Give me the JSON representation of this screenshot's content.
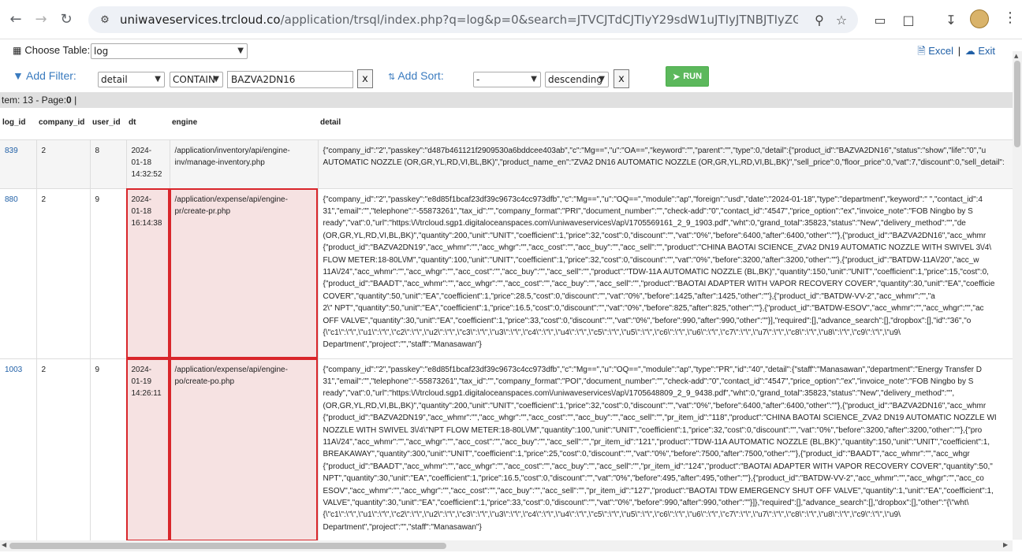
{
  "browser": {
    "url_host": "uniwaveservices.trcloud.co",
    "url_path": "/application/trsql/index.php?q=log&p=0&search=JTVCJTdCJTIyY29sdW1uJTIyJTNBJTIyZGV0YWlsJTIyJTJDJ..."
  },
  "toolbar": {
    "choose_table_label": "Choose Table:",
    "table_value": "log",
    "excel_label": "Excel",
    "separator": "|",
    "exit_label": "Exit",
    "add_filter_label": "Add Filter:",
    "filter_column": "detail",
    "filter_op": "CONTAIN",
    "filter_value": "BAZVA2DN16",
    "x_label": "x",
    "add_sort_label": "Add Sort:",
    "sort_column": "-",
    "sort_order": "descending",
    "run_label": "RUN",
    "item_info_prefix": "tem: 13 - Page:",
    "page_number": "0",
    "item_info_suffix": " |"
  },
  "columns": [
    "log_id",
    "company_id",
    "user_id",
    "dt",
    "engine",
    "detail"
  ],
  "rows": [
    {
      "log_id": "839",
      "company_id": "2",
      "user_id": "8",
      "dt": "2024-\n01-18\n14:32:52",
      "engine": "/application/inventory/api/engine-inv/manage-inventory.php",
      "detail": "{\"company_id\":\"2\",\"passkey\":\"d487b461121f2909530a6bddcee403ab\",\"c\":\"Mg==\",\"u\":\"OA==\",\"keyword\":\"\",\"parent\":\"\",\"type\":0,\"detail\":{\"product_id\":\"BAZVA2DN16\",\"status\":\"show\",\"life\":\"0\",\"u\nAUTOMATIC NOZZLE (OR,GR,YL,RD,VI,BL,BK)\",\"product_name_en\":\"ZVA2 DN16 AUTOMATIC NOZZLE (OR,GR,YL,RD,VI,BL,BK)\",\"sell_price\":0,\"floor_price\":0,\"vat\":7,\"discount\":0,\"sell_detail\":"
    },
    {
      "log_id": "880",
      "company_id": "2",
      "user_id": "9",
      "dt": "2024-\n01-18\n16:14:38",
      "engine": "/application/expense/api/engine-pr/create-pr.php",
      "detail": "{\"company_id\":\"2\",\"passkey\":\"e8d85f1bcaf23df39c9673c4cc973dfb\",\"c\":\"Mg==\",\"u\":\"OQ==\",\"module\":\"ap\",\"foreign\":\"usd\",\"date\":\"2024-01-18\",\"type\":\"department\",\"keyword\":\" \",\"contact_id\":4\n31\",\"email\":\"\",\"telephone\":\"-55873261\",\"tax_id\":\"\",\"company_format\":\"PRI\",\"document_number\":\"\",\"check-add\":\"0\",\"contact_id\":\"4547\",\"price_option\":\"ex\",\"invoice_note\":\"FOB Ningbo by S\nready\",\"vat\":0,\"url\":\"https:\\/\\/trcloud.sgp1.digitaloceanspaces.com\\/uniwaveservices\\/ap\\/1705569161_2_9_1903.pdf\",\"wht\":0,\"grand_total\":35823,\"status\":\"New\",\"delivery_method\":\"\",\"de\n(OR,GR,YL,RD,VI,BL,BK)\",\"quantity\":200,\"unit\":\"UNIT\",\"coefficient\":1,\"price\":32,\"cost\":0,\"discount\":\"\",\"vat\":\"0%\",\"before\":6400,\"after\":6400,\"other\":\"\"},{\"product_id\":\"BAZVA2DN16\",\"acc_whmr\n{\"product_id\":\"BAZVA2DN19\",\"acc_whmr\":\"\",\"acc_whgr\":\"\",\"acc_cost\":\"\",\"acc_buy\":\"\",\"acc_sell\":\"\",\"product\":\"CHINA BAOTAI SCIENCE_ZVA2 DN19 AUTOMATIC NOZZLE WITH SWIVEL 3\\/4\\\nFLOW METER:18-80L\\/M\",\"quantity\":100,\"unit\":\"UNIT\",\"coefficient\":1,\"price\":32,\"cost\":0,\"discount\":\"\",\"vat\":\"0%\",\"before\":3200,\"after\":3200,\"other\":\"\"},{\"product_id\":\"BATDW-11A\\/20\",\"acc_w\n11A\\/24\",\"acc_whmr\":\"\",\"acc_whgr\":\"\",\"acc_cost\":\"\",\"acc_buy\":\"\",\"acc_sell\":\"\",\"product\":\"TDW-11A AUTOMATIC NOZZLE (BL,BK)\",\"quantity\":150,\"unit\":\"UNIT\",\"coefficient\":1,\"price\":15,\"cost\":0,\n{\"product_id\":\"BAADT\",\"acc_whmr\":\"\",\"acc_whgr\":\"\",\"acc_cost\":\"\",\"acc_buy\":\"\",\"acc_sell\":\"\",\"product\":\"BAOTAI ADAPTER WITH VAPOR RECOVERY COVER\",\"quantity\":30,\"unit\":\"EA\",\"coefficie\nCOVER\",\"quantity\":50,\"unit\":\"EA\",\"coefficient\":1,\"price\":28.5,\"cost\":0,\"discount\":\"\",\"vat\":\"0%\",\"before\":1425,\"after\":1425,\"other\":\"\"},{\"product_id\":\"BATDW-VV-2\",\"acc_whmr\":\"\",\"a\n2\\\" NPT\",\"quantity\":50,\"unit\":\"EA\",\"coefficient\":1,\"price\":16.5,\"cost\":0,\"discount\":\"\",\"vat\":\"0%\",\"before\":825,\"after\":825,\"other\":\"\"},{\"product_id\":\"BATDW-ESOV\",\"acc_whmr\":\"\",\"acc_whgr\":\"\",\"ac\nOFF VALVE\",\"quantity\":30,\"unit\":\"EA\",\"coefficient\":1,\"price\":33,\"cost\":0,\"discount\":\"\",\"vat\":\"0%\",\"before\":990,\"after\":990,\"other\":\"\"}],\"required\":[],\"advance_search\":[],\"dropbox\":[],\"id\":\"36\",\"o\n{\\\"c1\\\":\\\"\\\",\\\"u1\\\":\\\"\\\",\\\"c2\\\":\\\"\\\",\\\"u2\\\":\\\"\\\",\\\"c3\\\":\\\"\\\",\\\"u3\\\":\\\"\\\",\\\"c4\\\":\\\"\\\",\\\"u4\\\":\\\"\\\",\\\"c5\\\":\\\"\\\",\\\"u5\\\":\\\"\\\",\\\"c6\\\":\\\"\\\",\\\"u6\\\":\\\"\\\",\\\"c7\\\":\\\"\\\",\\\"u7\\\":\\\"\\\",\\\"c8\\\":\\\"\\\",\\\"u8\\\":\\\"\\\",\\\"c9\\\":\\\"\\\",\\\"u9\\\nDepartment\",\"project\":\"\",\"staff\":\"Manasawan\"}"
    },
    {
      "log_id": "1003",
      "company_id": "2",
      "user_id": "9",
      "dt": "2024-\n01-19\n14:26:11",
      "engine": "/application/expense/api/engine-po/create-po.php",
      "detail": "{\"company_id\":\"2\",\"passkey\":\"e8d85f1bcaf23df39c9673c4cc973dfb\",\"c\":\"Mg==\",\"u\":\"OQ==\",\"module\":\"ap\",\"type\":\"PR\",\"id\":\"40\",\"detail\":{\"staff\":\"Manasawan\",\"department\":\"Energy Transfer D\n31\",\"email\":\"\",\"telephone\":\"-55873261\",\"tax_id\":\"\",\"company_format\":\"POI\",\"document_number\":\"\",\"check-add\":\"0\",\"contact_id\":\"4547\",\"price_option\":\"ex\",\"invoice_note\":\"FOB Ningbo by S\nready\",\"vat\":0,\"url\":\"https:\\/\\/trcloud.sgp1.digitaloceanspaces.com\\/uniwaveservices\\/ap\\/1705648809_2_9_9438.pdf\",\"wht\":0,\"grand_total\":35823,\"status\":\"New\",\"delivery_method\":\"\",\n(OR,GR,YL,RD,VI,BL,BK)\",\"quantity\":200,\"unit\":\"UNIT\",\"coefficient\":1,\"price\":32,\"cost\":0,\"discount\":\"\",\"vat\":\"0%\",\"before\":6400,\"after\":6400,\"other\":\"\"},{\"product_id\":\"BAZVA2DN16\",\"acc_whmr\n{\"product_id\":\"BAZVA2DN19\",\"acc_whmr\":\"\",\"acc_whgr\":\"\",\"acc_cost\":\"\",\"acc_buy\":\"\",\"acc_sell\":\"\",\"pr_item_id\":\"118\",\"product\":\"CHINA BAOTAI SCIENCE_ZVA2 DN19 AUTOMATIC NOZZLE WI\nNOZZLE WITH SWIVEL 3\\/4\\\"NPT FLOW METER:18-80L\\/M\",\"quantity\":100,\"unit\":\"UNIT\",\"coefficient\":1,\"price\":32,\"cost\":0,\"discount\":\"\",\"vat\":\"0%\",\"before\":3200,\"after\":3200,\"other\":\"\"},{\"pro\n11A\\/24\",\"acc_whmr\":\"\",\"acc_whgr\":\"\",\"acc_cost\":\"\",\"acc_buy\":\"\",\"acc_sell\":\"\",\"pr_item_id\":\"121\",\"product\":\"TDW-11A AUTOMATIC NOZZLE (BL,BK)\",\"quantity\":150,\"unit\":\"UNIT\",\"coefficient\":1,\nBREAKAWAY\",\"quantity\":300,\"unit\":\"UNIT\",\"coefficient\":1,\"price\":25,\"cost\":0,\"discount\":\"\",\"vat\":\"0%\",\"before\":7500,\"after\":7500,\"other\":\"\"},{\"product_id\":\"BAADT\",\"acc_whmr\":\"\",\"acc_whgr\n{\"product_id\":\"BAADT\",\"acc_whmr\":\"\",\"acc_whgr\":\"\",\"acc_cost\":\"\",\"acc_buy\":\"\",\"acc_sell\":\"\",\"pr_item_id\":\"124\",\"product\":\"BAOTAI ADAPTER WITH VAPOR RECOVERY COVER\",\"quantity\":50,\"\nNPT\",\"quantity\":30,\"unit\":\"EA\",\"coefficient\":1,\"price\":16.5,\"cost\":0,\"discount\":\"\",\"vat\":\"0%\",\"before\":495,\"after\":495,\"other\":\"\"},{\"product_id\":\"BATDW-VV-2\",\"acc_whmr\":\"\",\"acc_whgr\":\"\",\"acc_co\nESOV\",\"acc_whmr\":\"\",\"acc_whgr\":\"\",\"acc_cost\":\"\",\"acc_buy\":\"\",\"acc_sell\":\"\",\"pr_item_id\":\"127\",\"product\":\"BAOTAI TDW EMERGENCY SHUT OFF VALVE\",\"quantity\":1,\"unit\":\"EA\",\"coefficient\":1,\nVALVE\",\"quantity\":30,\"unit\":\"EA\",\"coefficient\":1,\"price\":33,\"cost\":0,\"discount\":\"\",\"vat\":\"0%\",\"before\":990,\"after\":990,\"other\":\"\"}]},\"required\":[],\"advance_search\":[],\"dropbox\":[],\"other\":\"{\\\"wht\\\n{\\\"c1\\\":\\\"\\\",\\\"u1\\\":\\\"\\\",\\\"c2\\\":\\\"\\\",\\\"u2\\\":\\\"\\\",\\\"c3\\\":\\\"\\\",\\\"u3\\\":\\\"\\\",\\\"c4\\\":\\\"\\\",\\\"u4\\\":\\\"\\\",\\\"c5\\\":\\\"\\\",\\\"u5\\\":\\\"\\\",\\\"c6\\\":\\\"\\\",\\\"u6\\\":\\\"\\\",\\\"c7\\\":\\\"\\\",\\\"u7\\\":\\\"\\\",\\\"c8\\\":\\\"\\\",\\\"u8\\\":\\\"\\\",\\\"c9\\\":\\\"\\\",\\\"u9\\\nDepartment\",\"project\":\"\",\"staff\":\"Manasawan\"}"
    }
  ],
  "highlight_color": "#d9262b",
  "link_color": "#1f5fa6",
  "run_color": "#5cb85c"
}
